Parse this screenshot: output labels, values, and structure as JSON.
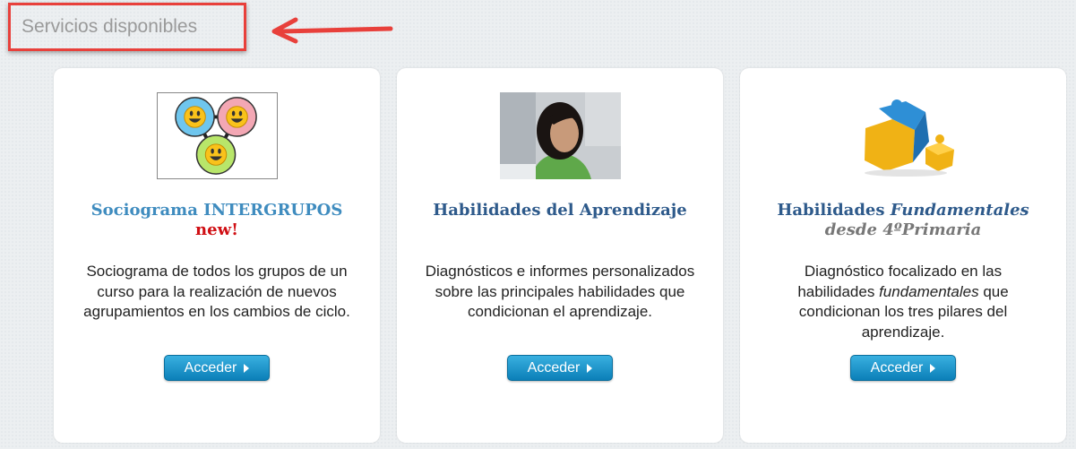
{
  "header": {
    "title": "Servicios disponibles"
  },
  "cards": [
    {
      "title": "Sociograma INTERGRUPOS",
      "badge": "new!",
      "description": "Sociograma de todos los grupos de un curso para la realización de nuevos agrupamientos en los cambios de ciclo.",
      "button": "Acceder"
    },
    {
      "title": "Habilidades del Aprendizaje",
      "description": "Diagnósticos e informes personalizados sobre las principales habilidades que condicionan el aprendizaje.",
      "button": "Acceder"
    },
    {
      "title_prefix": "Habilidades ",
      "title_emph": "Fundamentales",
      "subtitle": "desde 4ºPrimaria",
      "desc_pre": "Diagnóstico focalizado en las habilidades ",
      "desc_emph": "fundamentales",
      "desc_post": " que condicionan los tres pilares del aprendizaje.",
      "button": "Acceder"
    }
  ]
}
